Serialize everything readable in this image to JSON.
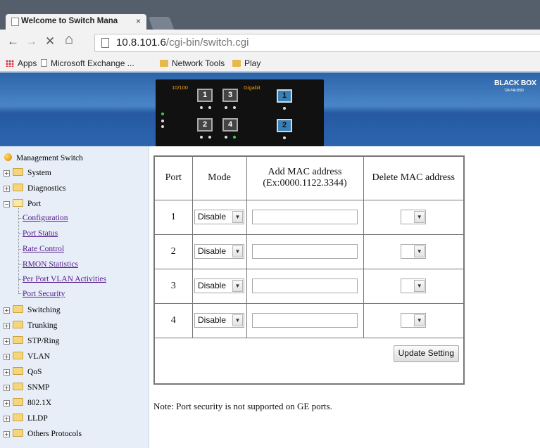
{
  "browser": {
    "tab_title": "Welcome to Switch Mana",
    "tab_close": "×",
    "url_host": "10.8.101.6",
    "url_path": "/cgi-bin/switch.cgi",
    "nav": {
      "back": "←",
      "forward": "→",
      "stop": "✕",
      "home": "⌂"
    },
    "bookmarks": [
      "Apps",
      "Microsoft Exchange ...",
      "Network Tools",
      "Play"
    ]
  },
  "switch_panel": {
    "label_10_100": "10/100",
    "label_gigabit": "Gigabit",
    "ports": [
      "1",
      "3",
      "2",
      "4"
    ],
    "gig_ports": [
      "1",
      "2"
    ]
  },
  "brand": {
    "name": "BLACK BOX",
    "phone": "724-746-5500"
  },
  "sidebar": {
    "root": "Management Switch",
    "items": [
      {
        "label": "System",
        "expanded": false
      },
      {
        "label": "Diagnostics",
        "expanded": false
      },
      {
        "label": "Port",
        "expanded": true
      },
      {
        "label": "Switching",
        "expanded": false
      },
      {
        "label": "Trunking",
        "expanded": false
      },
      {
        "label": "STP/Ring",
        "expanded": false
      },
      {
        "label": "VLAN",
        "expanded": false
      },
      {
        "label": "QoS",
        "expanded": false
      },
      {
        "label": "SNMP",
        "expanded": false
      },
      {
        "label": "802.1X",
        "expanded": false
      },
      {
        "label": "LLDP",
        "expanded": false
      },
      {
        "label": "Others Protocols",
        "expanded": false
      }
    ],
    "port_children": [
      "Configuration",
      "Port Status",
      "Rate Control",
      "RMON Statistics",
      "Per Port VLAN Activities",
      "Port Security"
    ],
    "plus": "+",
    "minus": "−"
  },
  "table": {
    "headers": {
      "port": "Port",
      "mode": "Mode",
      "add_mac": "Add MAC address",
      "add_mac_hint": "(Ex:0000.1122.3344)",
      "delete_mac": "Delete MAC address"
    },
    "rows": [
      {
        "port": "1",
        "mode": "Disable",
        "add_mac": "",
        "delete_mac": ""
      },
      {
        "port": "2",
        "mode": "Disable",
        "add_mac": "",
        "delete_mac": ""
      },
      {
        "port": "3",
        "mode": "Disable",
        "add_mac": "",
        "delete_mac": ""
      },
      {
        "port": "4",
        "mode": "Disable",
        "add_mac": "",
        "delete_mac": ""
      }
    ],
    "update_button": "Update Setting",
    "arrow": "▼"
  },
  "note": "Note: Port security is not supported on GE ports."
}
